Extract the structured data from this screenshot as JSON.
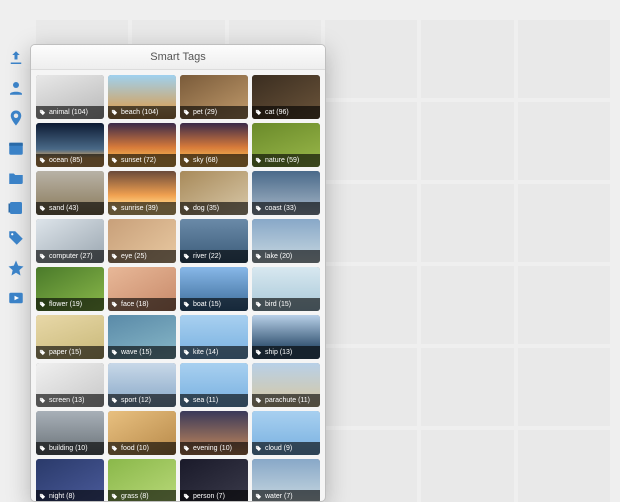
{
  "panel": {
    "title": "Smart Tags"
  },
  "rail": [
    {
      "name": "import-icon"
    },
    {
      "name": "people-icon"
    },
    {
      "name": "places-icon"
    },
    {
      "name": "calendar-icon"
    },
    {
      "name": "folder-icon"
    },
    {
      "name": "albums-icon"
    },
    {
      "name": "tags-icon"
    },
    {
      "name": "favorites-icon"
    },
    {
      "name": "media-icon"
    }
  ],
  "tags": [
    {
      "label": "animal",
      "count": 104,
      "cls": "g-grey"
    },
    {
      "label": "beach",
      "count": 104,
      "cls": "g-beach"
    },
    {
      "label": "pet",
      "count": 29,
      "cls": "g-pet"
    },
    {
      "label": "cat",
      "count": 96,
      "cls": "g-cat"
    },
    {
      "label": "ocean",
      "count": 85,
      "cls": "g-ocean"
    },
    {
      "label": "sunset",
      "count": 72,
      "cls": "g-sunset"
    },
    {
      "label": "sky",
      "count": 68,
      "cls": "g-sunset"
    },
    {
      "label": "nature",
      "count": 59,
      "cls": "g-nature"
    },
    {
      "label": "sand",
      "count": 43,
      "cls": "g-sand"
    },
    {
      "label": "sunrise",
      "count": 39,
      "cls": "g-sunrise"
    },
    {
      "label": "dog",
      "count": 35,
      "cls": "g-dog"
    },
    {
      "label": "coast",
      "count": 33,
      "cls": "g-coast"
    },
    {
      "label": "computer",
      "count": 27,
      "cls": "g-comp"
    },
    {
      "label": "eye",
      "count": 25,
      "cls": "g-eye"
    },
    {
      "label": "river",
      "count": 22,
      "cls": "g-river"
    },
    {
      "label": "lake",
      "count": 20,
      "cls": "g-lake"
    },
    {
      "label": "flower",
      "count": 19,
      "cls": "g-flower"
    },
    {
      "label": "face",
      "count": 18,
      "cls": "g-face"
    },
    {
      "label": "boat",
      "count": 15,
      "cls": "g-boat"
    },
    {
      "label": "bird",
      "count": 15,
      "cls": "g-bird"
    },
    {
      "label": "paper",
      "count": 15,
      "cls": "g-paper"
    },
    {
      "label": "wave",
      "count": 15,
      "cls": "g-wave"
    },
    {
      "label": "kite",
      "count": 14,
      "cls": "g-kite"
    },
    {
      "label": "ship",
      "count": 13,
      "cls": "g-ship"
    },
    {
      "label": "screen",
      "count": 13,
      "cls": "g-screen"
    },
    {
      "label": "sport",
      "count": 12,
      "cls": "g-sport"
    },
    {
      "label": "sea",
      "count": 11,
      "cls": "g-kite"
    },
    {
      "label": "parachute",
      "count": 11,
      "cls": "g-para"
    },
    {
      "label": "building",
      "count": 10,
      "cls": "g-build"
    },
    {
      "label": "food",
      "count": 10,
      "cls": "g-food"
    },
    {
      "label": "evening",
      "count": 10,
      "cls": "g-even"
    },
    {
      "label": "cloud",
      "count": 9,
      "cls": "g-kite"
    },
    {
      "label": "night",
      "count": 8,
      "cls": "g-blue"
    },
    {
      "label": "grass",
      "count": 8,
      "cls": "g-grass"
    },
    {
      "label": "person",
      "count": 7,
      "cls": "g-dark"
    },
    {
      "label": "water",
      "count": 7,
      "cls": "g-lake"
    }
  ]
}
